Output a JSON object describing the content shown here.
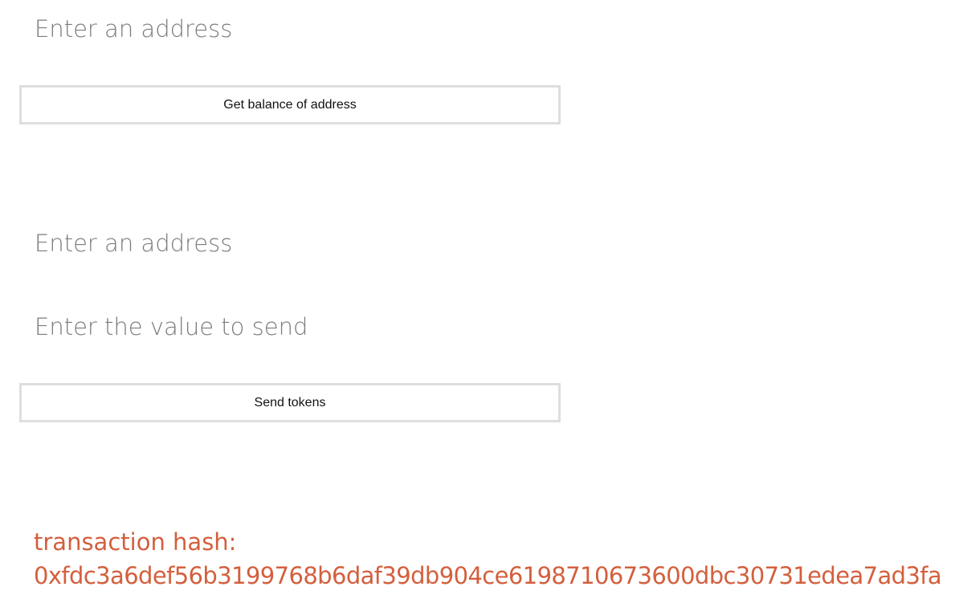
{
  "balance_form": {
    "address_placeholder": "Enter an address",
    "button_label": "Get balance of address"
  },
  "send_form": {
    "address_placeholder": "Enter an address",
    "value_placeholder": "Enter the value to send",
    "button_label": "Send tokens"
  },
  "transaction": {
    "label": "transaction hash:",
    "hash": "0xfdc3a6def56b3199768b6daf39db904ce6198710673600dbc30731edea7ad3fa"
  },
  "colors": {
    "button_border": "#dedede",
    "placeholder_text": "#7b7b7b",
    "hash_text": "#d45f3d"
  }
}
